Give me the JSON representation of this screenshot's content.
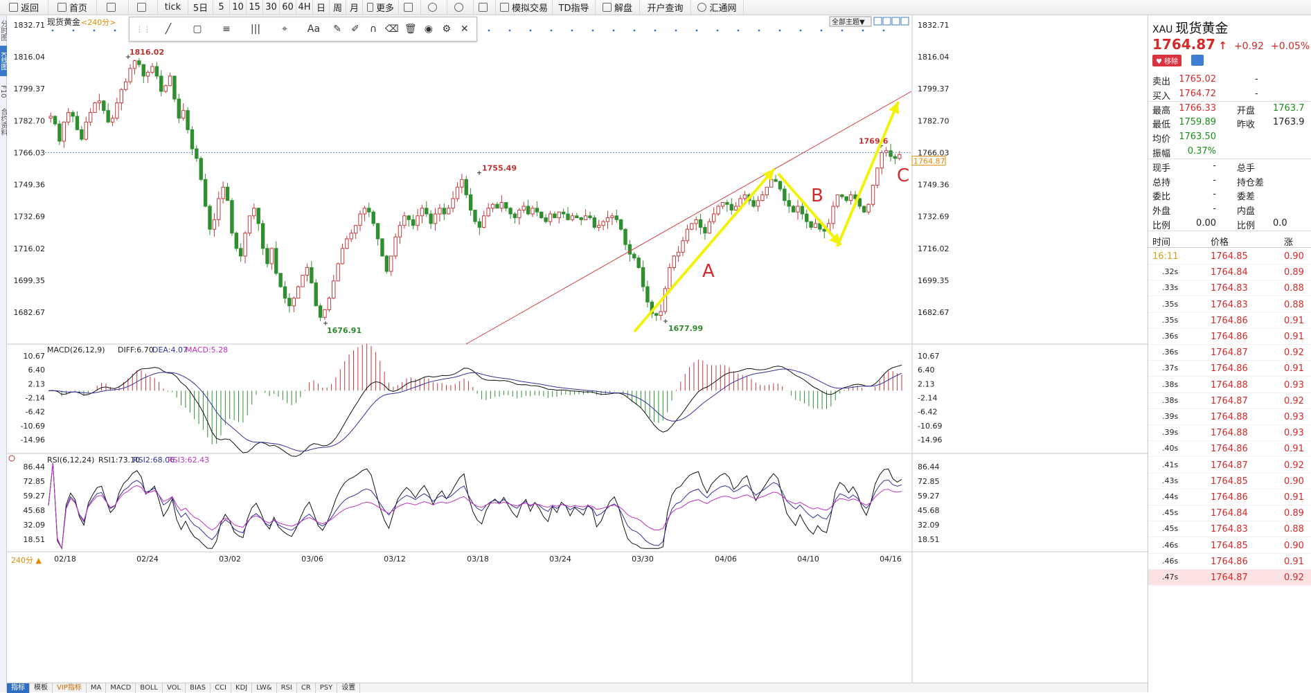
{
  "toolbar": {
    "items": [
      "返回",
      "首页",
      "",
      "",
      "tick",
      "5日",
      "5",
      "10",
      "15",
      "30",
      "60",
      "4H",
      "日",
      "周",
      "月",
      "更多",
      "",
      "",
      "",
      "",
      "模拟交易",
      "TD指导",
      "解盘",
      "开户查询",
      "汇通网"
    ]
  },
  "left_nav": [
    "分时图",
    "K线图",
    "F10",
    "合约资料"
  ],
  "draw_toolbar": [
    "╱",
    "▢",
    "≡",
    "|||",
    "⌖",
    "Aa",
    "✎",
    "✐",
    "∩",
    "⌫",
    "🗑",
    "◉",
    "⚙",
    "✕"
  ],
  "chart": {
    "symbol_label": "现货黄金",
    "period_label": "<240分>",
    "theme_button": "全部主题▼",
    "period_selector": "240分 ▲",
    "current_price_tag": "1764.87",
    "wave_labels": [
      "A",
      "B",
      "C"
    ]
  },
  "bottom_tabs": [
    "指标",
    "模板",
    "VIP指标",
    "MA",
    "MACD",
    "BOLL",
    "VOL",
    "BIAS",
    "CCI",
    "KDJ",
    "LW&",
    "RSI",
    "CR",
    "PSY",
    "设置"
  ],
  "chart_data": {
    "type": "candlestick",
    "title": "现货黄金 <240分>",
    "x_tick_labels": [
      "02/18",
      "02/24",
      "03/02",
      "03/06",
      "03/12",
      "03/18",
      "03/24",
      "03/30",
      "04/06",
      "04/10",
      "04/16"
    ],
    "price_axis": {
      "ticks": [
        1832.71,
        1816.04,
        1799.37,
        1782.7,
        1766.03,
        1749.36,
        1732.69,
        1716.02,
        1699.35,
        1682.67
      ],
      "range": [
        1670,
        1835
      ]
    },
    "annotations": [
      {
        "label": "1816.02",
        "value": 1816.02,
        "date": "02/22",
        "color": "#c03030"
      },
      {
        "label": "1676.91",
        "value": 1676.91,
        "date": "03/08",
        "color": "#2a8a2a"
      },
      {
        "label": "1755.49",
        "value": 1755.49,
        "date": "03/18",
        "color": "#c03030"
      },
      {
        "label": "1677.99",
        "value": 1677.99,
        "date": "03/31",
        "color": "#2a8a2a"
      },
      {
        "label": "1769.6",
        "value": 1769.6,
        "date": "04/15",
        "color": "#c03030"
      }
    ],
    "last_price": 1764.87,
    "ohlc_path": [
      1784,
      1785,
      1781,
      1772,
      1782,
      1787,
      1785,
      1778,
      1773,
      1782,
      1787,
      1792,
      1793,
      1788,
      1782,
      1784,
      1792,
      1799,
      1803,
      1810,
      1814,
      1812,
      1806,
      1808,
      1811,
      1806,
      1798,
      1801,
      1806,
      1794,
      1784,
      1788,
      1778,
      1768,
      1763,
      1752,
      1738,
      1726,
      1731,
      1742,
      1748,
      1741,
      1724,
      1716,
      1712,
      1724,
      1733,
      1737,
      1729,
      1716,
      1708,
      1716,
      1703,
      1696,
      1690,
      1686,
      1690,
      1696,
      1702,
      1706,
      1698,
      1686,
      1680,
      1684,
      1690,
      1699,
      1708,
      1716,
      1721,
      1724,
      1728,
      1734,
      1737,
      1735,
      1729,
      1721,
      1712,
      1704,
      1712,
      1722,
      1728,
      1733,
      1731,
      1728,
      1733,
      1737,
      1734,
      1729,
      1734,
      1737,
      1734,
      1737,
      1742,
      1748,
      1752,
      1744,
      1736,
      1730,
      1727,
      1733,
      1737,
      1739,
      1737,
      1740,
      1737,
      1734,
      1732,
      1736,
      1738,
      1734,
      1737,
      1735,
      1732,
      1730,
      1734,
      1732,
      1735,
      1734,
      1731,
      1733,
      1732,
      1731,
      1733,
      1732,
      1727,
      1728,
      1730,
      1732,
      1733,
      1731,
      1726,
      1718,
      1713,
      1711,
      1706,
      1696,
      1688,
      1682,
      1681,
      1683,
      1695,
      1706,
      1712,
      1714,
      1720,
      1726,
      1729,
      1731,
      1727,
      1724,
      1730,
      1734,
      1738,
      1740,
      1739,
      1736,
      1738,
      1742,
      1744,
      1741,
      1738,
      1741,
      1744,
      1748,
      1752,
      1751,
      1747,
      1741,
      1738,
      1735,
      1738,
      1734,
      1730,
      1727,
      1729,
      1726,
      1725,
      1729,
      1738,
      1744,
      1743,
      1741,
      1744,
      1742,
      1738,
      1735,
      1739,
      1749,
      1758,
      1766,
      1767,
      1764,
      1763,
      1765
    ]
  },
  "macd": {
    "label": "MACD(26,12,9)",
    "diff": "DIFF:6.70",
    "dea": "DEA:4.07",
    "macd": "MACD:5.28",
    "ticks": [
      10.67,
      6.4,
      2.13,
      -2.14,
      -6.42,
      -10.69,
      -14.96
    ],
    "range": [
      -17,
      12
    ]
  },
  "rsi": {
    "label": "RSI(6,12,24)",
    "rsi1": "RSI1:73.10",
    "rsi2": "RSI2:68.06",
    "rsi3": "RSI3:62.43",
    "ticks": [
      86.44,
      72.85,
      59.27,
      45.68,
      32.09,
      18.51
    ],
    "range": [
      8,
      92
    ]
  },
  "quote": {
    "code": "XAU",
    "name": "现货黄金",
    "price": "1764.87",
    "arrow": "↑",
    "change": "+0.92",
    "change_pct": "+0.05%",
    "btn_remove": "♥ 移除",
    "rows": [
      {
        "l1": "卖出",
        "v1": "1765.02",
        "l2": "-",
        "v2": "",
        "c1": "red",
        "c2": "dark"
      },
      {
        "l1": "买入",
        "v1": "1764.72",
        "l2": "-",
        "v2": "",
        "c1": "red",
        "c2": "dark"
      },
      {
        "l1": "最高",
        "v1": "1766.33",
        "l2": "开盘",
        "v2": "1763.7",
        "c1": "red",
        "c2": "green"
      },
      {
        "l1": "最低",
        "v1": "1759.89",
        "l2": "昨收",
        "v2": "1763.9",
        "c1": "green",
        "c2": "dark"
      },
      {
        "l1": "均价",
        "v1": "1763.50",
        "l2": "",
        "v2": "",
        "c1": "green",
        "c2": "dark"
      },
      {
        "l1": "振幅",
        "v1": "0.37%",
        "l2": "",
        "v2": "",
        "c1": "green",
        "c2": "dark"
      },
      {
        "l1": "现手",
        "v1": "-",
        "l2": "总手",
        "v2": "",
        "c1": "dark",
        "c2": "dark"
      },
      {
        "l1": "总持",
        "v1": "-",
        "l2": "持仓差",
        "v2": "",
        "c1": "dark",
        "c2": "dark"
      },
      {
        "l1": "委比",
        "v1": "-",
        "l2": "委差",
        "v2": "",
        "c1": "dark",
        "c2": "dark"
      },
      {
        "l1": "外盘",
        "v1": "-",
        "l2": "内盘",
        "v2": "",
        "c1": "dark",
        "c2": "dark"
      },
      {
        "l1": "比例",
        "v1": "0.00",
        "l2": "比例",
        "v2": "0.0",
        "c1": "dark",
        "c2": "dark"
      }
    ],
    "tick_header": [
      "时间",
      "价格",
      "涨"
    ],
    "ticks": [
      {
        "t": "16:11",
        "p": "1764.85",
        "c": "0.90"
      },
      {
        "t": ".32s",
        "p": "1764.84",
        "c": "0.89"
      },
      {
        "t": ".33s",
        "p": "1764.83",
        "c": "0.88"
      },
      {
        "t": ".35s",
        "p": "1764.83",
        "c": "0.88"
      },
      {
        "t": ".35s",
        "p": "1764.86",
        "c": "0.91"
      },
      {
        "t": ".36s",
        "p": "1764.86",
        "c": "0.91"
      },
      {
        "t": ".36s",
        "p": "1764.87",
        "c": "0.92"
      },
      {
        "t": ".37s",
        "p": "1764.86",
        "c": "0.91"
      },
      {
        "t": ".38s",
        "p": "1764.88",
        "c": "0.93"
      },
      {
        "t": ".38s",
        "p": "1764.87",
        "c": "0.92"
      },
      {
        "t": ".39s",
        "p": "1764.88",
        "c": "0.93"
      },
      {
        "t": ".39s",
        "p": "1764.88",
        "c": "0.93"
      },
      {
        "t": ".40s",
        "p": "1764.86",
        "c": "0.91"
      },
      {
        "t": ".41s",
        "p": "1764.87",
        "c": "0.92"
      },
      {
        "t": ".43s",
        "p": "1764.85",
        "c": "0.90"
      },
      {
        "t": ".44s",
        "p": "1764.86",
        "c": "0.91"
      },
      {
        "t": ".45s",
        "p": "1764.84",
        "c": "0.89"
      },
      {
        "t": ".45s",
        "p": "1764.83",
        "c": "0.88"
      },
      {
        "t": ".46s",
        "p": "1764.85",
        "c": "0.90"
      },
      {
        "t": ".46s",
        "p": "1764.86",
        "c": "0.91"
      },
      {
        "t": ".47s",
        "p": "1764.87",
        "c": "0.92"
      }
    ]
  }
}
